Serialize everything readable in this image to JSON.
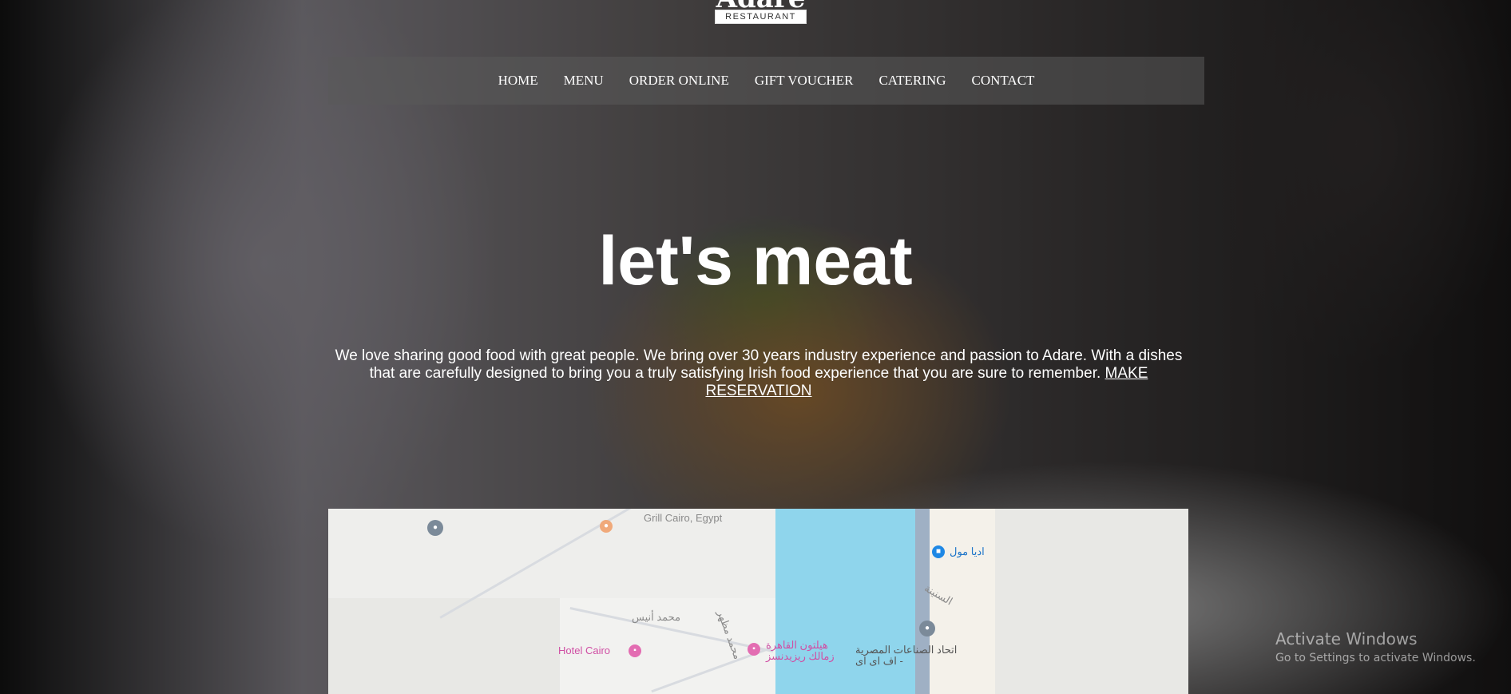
{
  "logo": {
    "script": "Adare",
    "badge": "RESTAURANT"
  },
  "nav": {
    "items": [
      {
        "label": "HOME"
      },
      {
        "label": "MENU"
      },
      {
        "label": "ORDER ONLINE"
      },
      {
        "label": "GIFT VOUCHER"
      },
      {
        "label": "CATERING"
      },
      {
        "label": "CONTACT"
      }
    ]
  },
  "hero": {
    "headline": "let's meat",
    "intro": "We love sharing good food with great people. We bring over 30 years industry experience and passion to Adare. With a dishes that are carefully designed to bring you a truly satisfying Irish food experience that you are sure to remember.",
    "cta": "MAKE RESERVATION"
  },
  "map": {
    "labels": {
      "grill": "Grill Cairo, Egypt",
      "hotel": "Hotel Cairo",
      "hilton": "هيلتون القاهرة زمالك ريزيدنسز",
      "union": "اتحاد الصناعات المصرية - اف اى اى",
      "mall": "اديا مول",
      "street1": "محمد أنيس",
      "street2": "محمد مظهر",
      "street3": "السنينة"
    }
  },
  "watermark": {
    "title": "Activate Windows",
    "subtitle": "Go to Settings to activate Windows."
  }
}
